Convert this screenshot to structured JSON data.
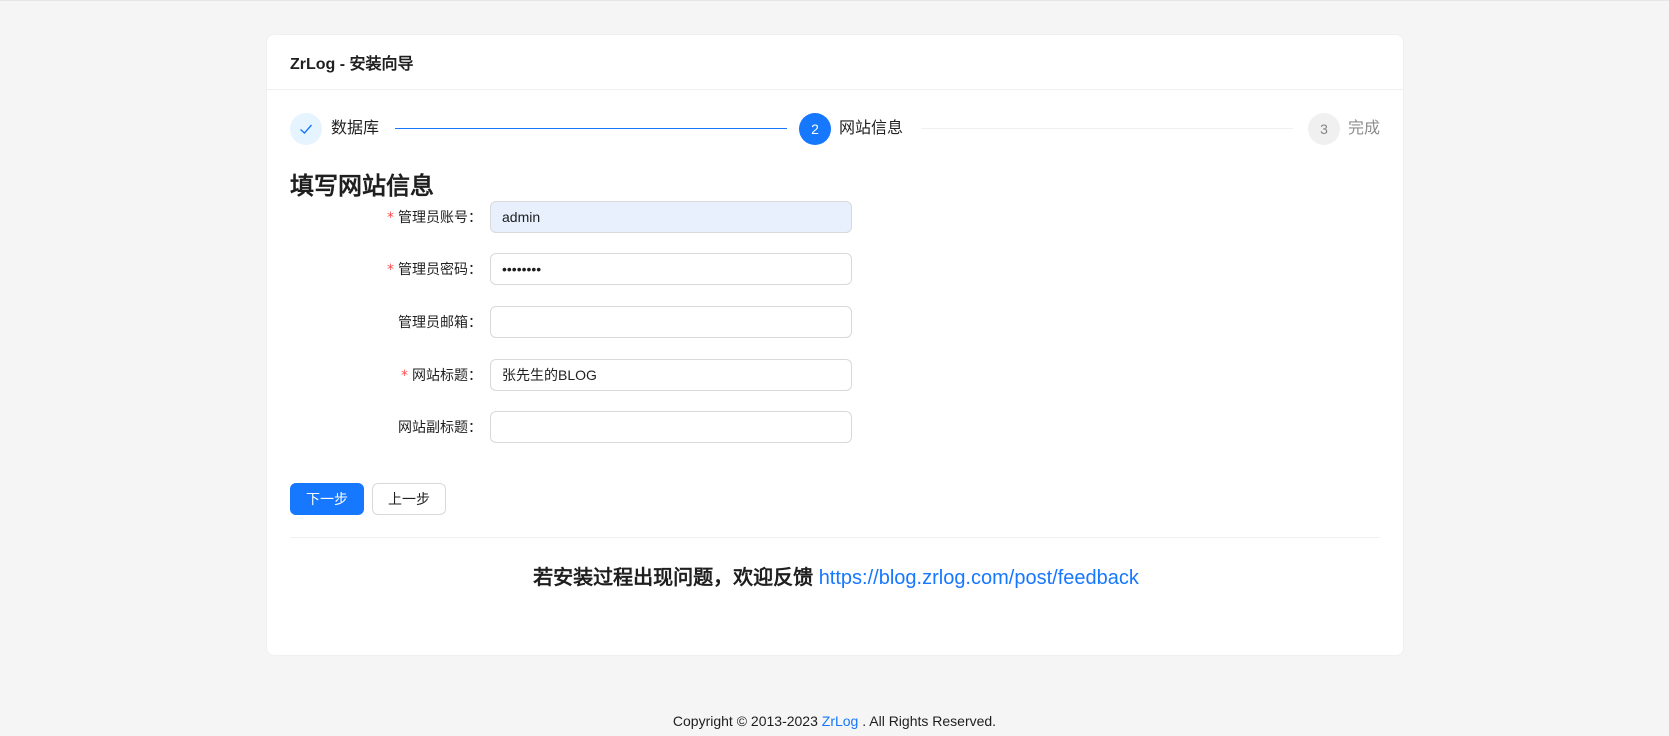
{
  "header": {
    "title": "ZrLog - 安装向导"
  },
  "steps": [
    {
      "number": "1",
      "title": "数据库",
      "status": "finish"
    },
    {
      "number": "2",
      "title": "网站信息",
      "status": "process"
    },
    {
      "number": "3",
      "title": "完成",
      "status": "wait"
    }
  ],
  "icons": {
    "step1": "check-icon"
  },
  "form": {
    "title": "填写网站信息",
    "fields": [
      {
        "label": "管理员账号：",
        "required": true,
        "value": "admin",
        "type": "text"
      },
      {
        "label": "管理员密码：",
        "required": true,
        "value": "••••••••",
        "type": "password"
      },
      {
        "label": "管理员邮箱：",
        "required": false,
        "value": "",
        "type": "text"
      },
      {
        "label": "网站标题：",
        "required": true,
        "value": "张先生的BLOG",
        "type": "text"
      },
      {
        "label": "网站副标题：",
        "required": false,
        "value": "",
        "type": "text"
      }
    ],
    "required_mark": "*"
  },
  "buttons": {
    "next": "下一步",
    "prev": "上一步"
  },
  "feedback": {
    "text": "若安装过程出现问题，欢迎反馈 ",
    "link": "https://blog.zrlog.com/post/feedback"
  },
  "footer": {
    "prefix": "Copyright © 2013-2023 ",
    "link": "ZrLog",
    "suffix": " . All Rights Reserved."
  },
  "colors": {
    "primary": "#1677ff",
    "required": "#ff4d4f",
    "background": "#f5f5f5"
  }
}
